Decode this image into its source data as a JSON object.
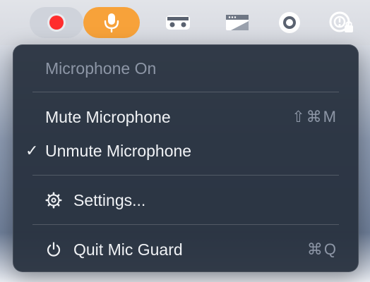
{
  "menubar": {
    "icons": [
      "record-icon",
      "microphone-icon",
      "cast-icon",
      "screen-icon",
      "record-circle-icon",
      "clock-lock-icon"
    ],
    "colors": {
      "active_pill": "#f7a23a",
      "record_dot": "#ff2d2d"
    }
  },
  "menu": {
    "status": "Microphone On",
    "mute": {
      "label": "Mute Microphone",
      "shortcut": "⇧⌘M"
    },
    "unmute": {
      "label": "Unmute Microphone",
      "check": "✓"
    },
    "settings": {
      "label": "Settings...",
      "icon": "gear-icon"
    },
    "quit": {
      "label": "Quit Mic Guard",
      "shortcut": "⌘Q",
      "icon": "power-icon"
    }
  }
}
